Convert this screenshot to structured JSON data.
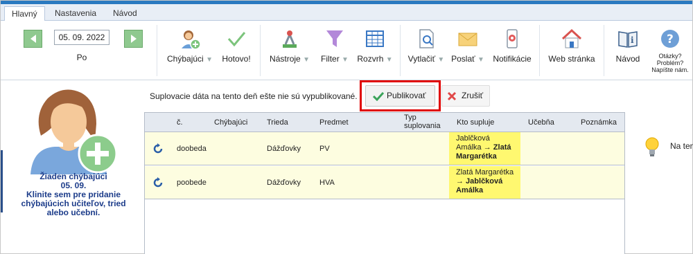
{
  "tabs": [
    {
      "label": "Hlavný"
    },
    {
      "label": "Nastavenia"
    },
    {
      "label": "Návod"
    }
  ],
  "date": {
    "value": "05. 09. 2022",
    "day": "Po"
  },
  "ribbon": {
    "chybajuci": "Chýbajúci",
    "hotovo": "Hotovo!",
    "nastroje": "Nástroje",
    "filter": "Filter",
    "rozvrh": "Rozvrh",
    "vytlacit": "Vytlačiť",
    "poslat": "Poslať",
    "notifikacie": "Notifikácie",
    "web": "Web stránka",
    "navod": "Návod",
    "otazky": [
      "Otázky?",
      "Problém?",
      "Napíšte nám."
    ]
  },
  "left": {
    "lines": [
      "Žiaden chýbajúci",
      "05. 09.",
      "Klinite sem pre pridanie",
      "chýbajúcich učiteľov, tried",
      "alebo učební."
    ]
  },
  "notice": "Suplovacie dáta na tento deň ešte nie sú vypublikované.",
  "buttons": {
    "publish": "Publikovať",
    "cancel": "Zrušiť"
  },
  "table": {
    "headers": {
      "c": "č.",
      "chybajuci": "Chýbajúci",
      "trieda": "Trieda",
      "predmet": "Predmet",
      "typ": [
        "Typ",
        "suplovania"
      ],
      "kto": "Kto supluje",
      "ucebna": "Učebňa",
      "poznamka": "Poznámka"
    },
    "rows": [
      {
        "c": "doobeda",
        "trieda": "Dážďovky",
        "predmet": "PV",
        "kto_lines": [
          "Jablčková",
          "Amálka",
          "→ Zlatá",
          "Margarétka"
        ]
      },
      {
        "c": "poobede",
        "trieda": "Dážďovky",
        "predmet": "HVA",
        "kto_lines": [
          "Zlatá Margarétka",
          "→ Jablčková",
          "Amálka"
        ]
      }
    ]
  },
  "hint": "Na ten"
}
